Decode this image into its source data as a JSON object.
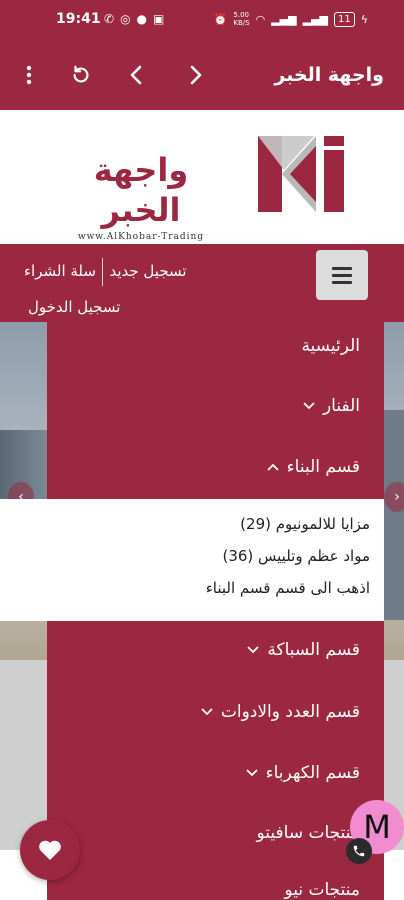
{
  "status_bar": {
    "time": "19:41",
    "network_speed": "5.00\nKB/S",
    "battery": "11"
  },
  "app_bar": {
    "title": "واجهة الخبر"
  },
  "logo": {
    "title": "واجهة الخبر",
    "subtitle": "www.AlKhobar-Trading"
  },
  "nav": {
    "register": "تسجيل جديد",
    "cart": "سلة الشراء",
    "login": "تسجيل الدخول"
  },
  "menu": {
    "items": [
      {
        "label": "الرئيسية",
        "chevron": ""
      },
      {
        "label": "الفنار",
        "chevron": "down"
      },
      {
        "label": "قسم البناء",
        "chevron": "up"
      },
      {
        "label": "قسم السباكة",
        "chevron": "down"
      },
      {
        "label": "قسم العدد والادوات",
        "chevron": "down"
      },
      {
        "label": "قسم الكهرباء",
        "chevron": "down"
      },
      {
        "label": "منتجات سافيتو",
        "chevron": ""
      },
      {
        "label": "منتجات نيو",
        "chevron": ""
      }
    ],
    "submenu": [
      {
        "label": "مزايا للالمونيوم (29)"
      },
      {
        "label": "مواد عظم وتلييس (36)"
      },
      {
        "label": "اذهب الى قسم قسم البناء"
      }
    ]
  },
  "floating": {
    "chat_letter": "M"
  },
  "colors": {
    "brand": "#9b2740",
    "chat_bubble": "#f28cd0"
  }
}
